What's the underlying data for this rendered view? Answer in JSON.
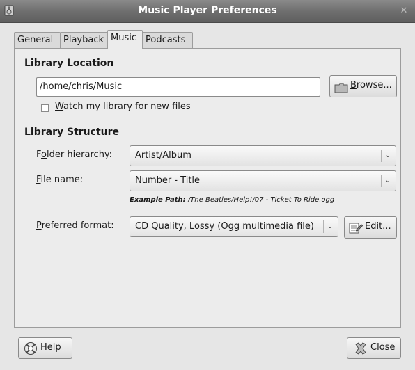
{
  "window": {
    "title": "Music Player Preferences"
  },
  "tabs": [
    {
      "label": "General"
    },
    {
      "label": "Playback"
    },
    {
      "label": "Music"
    },
    {
      "label": "Podcasts"
    }
  ],
  "active_tab": "Music",
  "library_location": {
    "heading_mnemonic": "L",
    "heading_rest": "ibrary Location",
    "path": "/home/chris/Music",
    "browse_mnemonic": "B",
    "browse_rest": "rowse...",
    "watch_mnemonic": "W",
    "watch_rest": "atch my library for new files",
    "watch_checked": false
  },
  "library_structure": {
    "heading": "Library Structure",
    "folder_label_a": "F",
    "folder_label_mn": "o",
    "folder_label_b": "lder hierarchy:",
    "folder_value": "Artist/Album",
    "file_label_mn": "F",
    "file_label_rest": "ile name:",
    "file_value": "Number - Title",
    "example_label": "Example Path:",
    "example_value": "/The Beatles/Help!/07 - Ticket To Ride.ogg",
    "format_label_mn": "P",
    "format_label_rest": "referred format:",
    "format_value": "CD Quality, Lossy (Ogg multimedia file)",
    "edit_mnemonic": "E",
    "edit_rest": "dit..."
  },
  "footer": {
    "help_mnemonic": "H",
    "help_rest": "elp",
    "close_mnemonic": "C",
    "close_rest": "lose"
  }
}
